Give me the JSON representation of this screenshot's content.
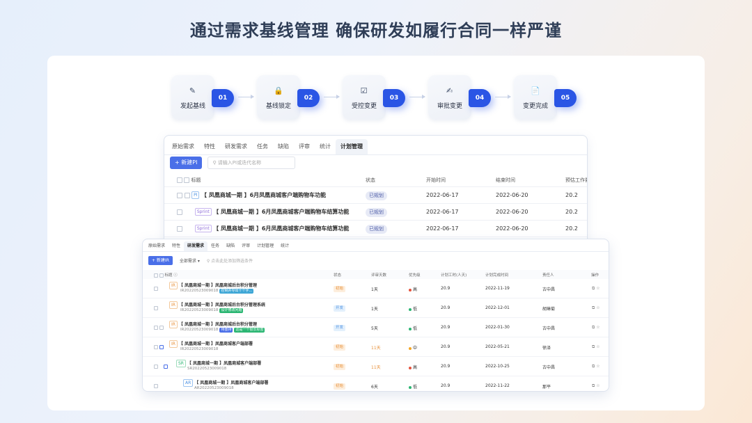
{
  "headline": "通过需求基线管理  确保研发如履行合同一样严谨",
  "steps": [
    {
      "num": "01",
      "label": "发起基线",
      "icon": "edit-doc-icon"
    },
    {
      "num": "02",
      "label": "基线锁定",
      "icon": "lock-icon"
    },
    {
      "num": "03",
      "label": "受控变更",
      "icon": "checklist-icon"
    },
    {
      "num": "04",
      "label": "审批变更",
      "icon": "approval-icon"
    },
    {
      "num": "05",
      "label": "变更完成",
      "icon": "done-doc-icon"
    }
  ],
  "win1": {
    "tabs": [
      "原始需求",
      "特性",
      "研发需求",
      "任务",
      "缺陷",
      "评审",
      "统计",
      "计划管理"
    ],
    "active_tab": "计划管理",
    "new_button": "+ 新建PI",
    "search_placeholder": "请输入PI或迭代名称",
    "columns": [
      "标题",
      "状态",
      "开始时间",
      "结束时间",
      "预估工作量"
    ],
    "rows": [
      {
        "tag": "PI",
        "title": "【 凤凰商城一期 】6月凤凰商城客户端购物车功能",
        "status": "已规划",
        "start": "2022-06-17",
        "end": "2022-06-20",
        "effort": "20.2"
      },
      {
        "tag": "Sprint",
        "title": "【 凤凰商城一期 】6月凤凰商城客户端购物车结算功能",
        "status": "已规划",
        "start": "2022-06-17",
        "end": "2022-06-20",
        "effort": "20.2"
      },
      {
        "tag": "Sprint",
        "title": "【 凤凰商城一期 】6月凤凰商城客户端购物车结算功能",
        "status": "已规划",
        "start": "2022-06-17",
        "end": "2022-06-20",
        "effort": "20.2"
      }
    ]
  },
  "win2": {
    "tabs": [
      "原始需求",
      "特性",
      "研发需求",
      "任务",
      "缺陷",
      "评审",
      "计划管理",
      "统计"
    ],
    "active_tab": "研发需求",
    "new_button": "+ 新建IR",
    "filter": "全部需求",
    "search_placeholder": "点击此处添加筛选条件",
    "columns": [
      "标题",
      "状态",
      "评审天数",
      "优先级",
      "计划工时(人天)",
      "计划完成时间",
      "责任人",
      "操作"
    ],
    "rows": [
      {
        "tag": "IR",
        "title": "【 凤凰商城一期 】凤凰商城后台积分管理",
        "code": "IR20220523009018",
        "labels": [
          "控制并导出十个字..."
        ],
        "status": "初始",
        "days": "1天",
        "priority": "高",
        "hours": "20.9",
        "date": "2022-11-19",
        "owner": "古中昌"
      },
      {
        "tag": "IR",
        "title": "【 凤凰商城一期 】凤凰商城后台积分管理系统",
        "code": "IR20220523009018",
        "labels": [
          "设计修改问题"
        ],
        "status": "开发",
        "days": "1天",
        "priority": "低",
        "hours": "20.9",
        "date": "2022-12-01",
        "owner": "胡琳菊"
      },
      {
        "tag": "IR",
        "title": "【 凤凰商城一期 】凤凰商城后台积分管理",
        "code": "IR20220523009018",
        "labels": [
          "待重排",
          "这是一个很长标签"
        ],
        "status": "开发",
        "days": "5天",
        "priority": "低",
        "hours": "20.9",
        "date": "2022-01-30",
        "owner": "古中昌"
      },
      {
        "tag": "IR",
        "title": "【 凤凰商城一期 】凤凰商城客户端部署",
        "code": "IR20220523009018",
        "labels": [],
        "status": "初始",
        "days": "11天",
        "priority": "中",
        "hours": "20.9",
        "date": "2022-05-21",
        "owner": "徐泽"
      },
      {
        "tag": "SR",
        "title": "【 凤凰商城一期 】凤凰商城客户端部署",
        "code": "SR20220523009018",
        "labels": [],
        "status": "初始",
        "days": "11天",
        "priority": "高",
        "hours": "20.9",
        "date": "2022-10-25",
        "owner": "古中昌"
      },
      {
        "tag": "AR",
        "title": "【 凤凰商城一期 】凤凰商城客户端部署",
        "code": "AR20220523009018",
        "labels": [],
        "status": "初始",
        "days": "6天",
        "priority": "低",
        "hours": "20.9",
        "date": "2022-11-22",
        "owner": "那平"
      }
    ]
  },
  "colors": {
    "accent": "#2a55e5",
    "new_button": "#4a6fe8",
    "high": "#e5533d",
    "low": "#2bb673",
    "mid": "#f5a623"
  }
}
